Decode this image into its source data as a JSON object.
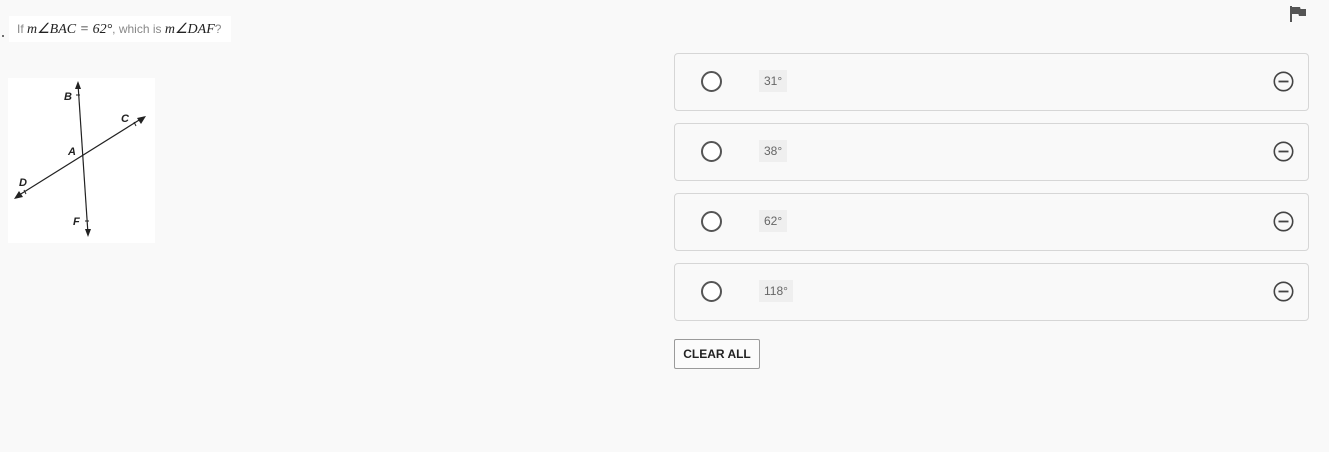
{
  "question": {
    "prefix": "If",
    "given_measure": "m∠BAC = 62°",
    "middle": ", which is",
    "asked_measure": "m∠DAF",
    "suffix": "?"
  },
  "diagram": {
    "labels": {
      "B": "B",
      "C": "C",
      "A": "A",
      "D": "D",
      "F": "F"
    }
  },
  "choices": [
    {
      "label": "31°"
    },
    {
      "label": "38°"
    },
    {
      "label": "62°"
    },
    {
      "label": "118°"
    }
  ],
  "clear_all_label": "CLEAR ALL",
  "icons": {
    "flag": "flag-icon",
    "radio": "radio-circle-icon",
    "eliminate": "minus-circle-icon"
  },
  "colors": {
    "background": "#f9f9f9",
    "border": "#d6d6d6",
    "icon": "#555555"
  }
}
